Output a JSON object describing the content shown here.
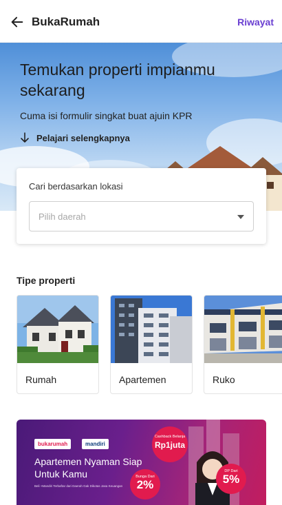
{
  "header": {
    "title": "BukaRumah",
    "history_label": "Riwayat"
  },
  "hero": {
    "title": "Temukan properti impianmu sekarang",
    "subtitle": "Cuma isi formulir singkat buat ajuin KPR",
    "learn_more": "Pelajari selengkapnya"
  },
  "search": {
    "label": "Cari berdasarkan lokasi",
    "placeholder": "Pilih daerah"
  },
  "property_types": {
    "title": "Tipe properti",
    "items": [
      {
        "label": "Rumah"
      },
      {
        "label": "Apartemen"
      },
      {
        "label": "Ruko"
      }
    ]
  },
  "banner": {
    "logo_left": "bukarumah",
    "logo_right": "mandiri",
    "title": "Apartemen Nyaman Siap Untuk Kamu",
    "fine_print": "Beli +Mandiri Terbaftar dari Daerah Gak Dikotas Jasa Keuangan",
    "cashback_small": "Cashback Belanja",
    "cashback_big": "Rp1juta",
    "interest_small": "Bunga Dari",
    "interest_big": "2%",
    "dp_small": "DP Dari",
    "dp_big": "5%"
  },
  "colors": {
    "accent": "#6a3fd1",
    "banner_pink": "#e11b4e"
  }
}
